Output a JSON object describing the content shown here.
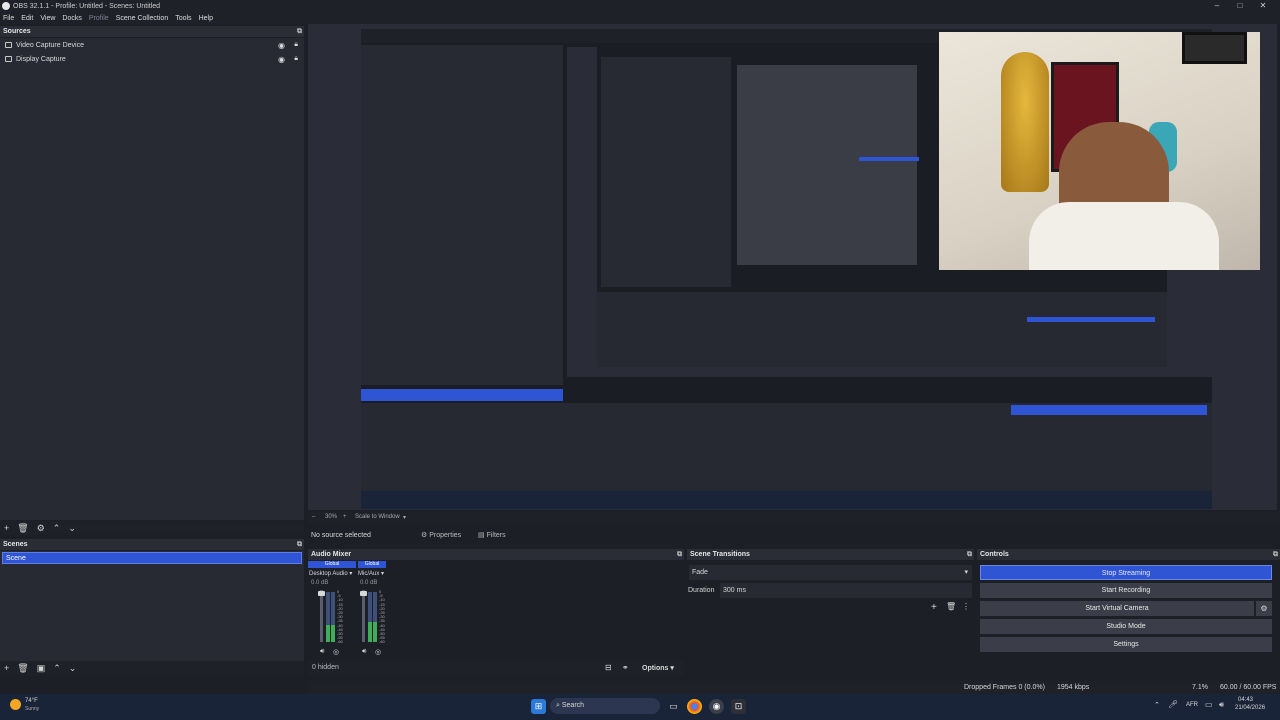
{
  "window": {
    "title": "OBS 32.1.1 - Profile: Untitled - Scenes: Untitled"
  },
  "menu": [
    "File",
    "Edit",
    "View",
    "Docks",
    "Profile",
    "Scene Collection",
    "Tools",
    "Help"
  ],
  "sources": {
    "header": "Sources",
    "items": [
      {
        "label": "Video Capture Device"
      },
      {
        "label": "Display Capture"
      }
    ]
  },
  "scenes": {
    "header": "Scenes",
    "items": [
      {
        "label": "Scene"
      }
    ]
  },
  "context_bar": {
    "no_source": "No source selected",
    "properties": "Properties",
    "filters": "Filters"
  },
  "zoom": {
    "percent": "30%",
    "scale_to_window": "Scale to Window"
  },
  "audio_mixer": {
    "header": "Audio Mixer",
    "channels": [
      {
        "scope": "Global",
        "name": "Desktop Audio",
        "db": "0.0 dB",
        "level": 0.35
      },
      {
        "scope": "Global",
        "name": "Mic/Aux",
        "db": "0.0 dB",
        "level": 0.4
      }
    ],
    "scale": [
      "0",
      "-5",
      "-10",
      "-15",
      "-20",
      "-25",
      "-30",
      "-35",
      "-40",
      "-45",
      "-50",
      "-55",
      "-60"
    ],
    "hidden": "0 hidden",
    "options": "Options"
  },
  "transitions": {
    "header": "Scene Transitions",
    "selected": "Fade",
    "duration_label": "Duration",
    "duration_value": "300 ms"
  },
  "controls": {
    "header": "Controls",
    "buttons": [
      "Stop Streaming",
      "Start Recording",
      "Start Virtual Camera",
      "Studio Mode",
      "Settings"
    ]
  },
  "status": {
    "dropped": "Dropped Frames 0 (0.0%)",
    "bitrate": "1954 kbps",
    "cpu": "7.1%",
    "fps": "60.00 / 60.00 FPS"
  },
  "weather": {
    "temp": "74°F",
    "desc": "Sunny"
  },
  "taskbar": {
    "search": "Search",
    "lang": "AFR",
    "time": "04:43",
    "date": "21/04/2026"
  },
  "colors": {
    "accent": "#2f55d4",
    "panel": "#272a33",
    "dock_header": "#2a2d36",
    "background": "#1d1f26",
    "meter_green": "#3fae5a",
    "meter_blue": "#3e4f7a"
  }
}
